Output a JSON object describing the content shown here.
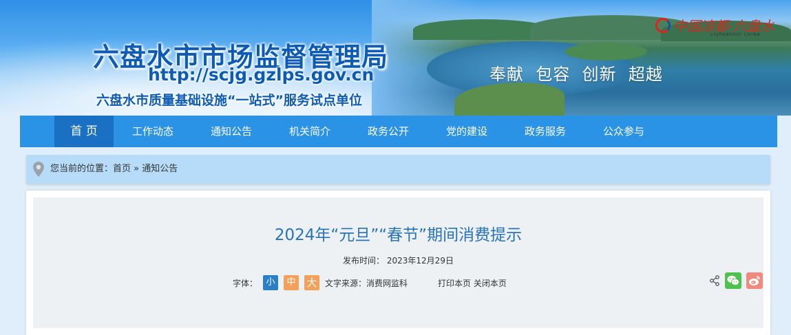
{
  "header": {
    "site_title": "六盘水市市场监督管理局",
    "site_url": "http://scjg.gzlps.gov.cn",
    "subtitle": "六盘水市质量基础设施“一站式”服务试点单位",
    "slogan": "奉献  包容  创新  超越",
    "city_logo_text": "中国凉都·六盘水",
    "city_logo_small": "LIUPANSHUI CHINA"
  },
  "nav": {
    "items": [
      {
        "label": "首 页",
        "active": true
      },
      {
        "label": "工作动态"
      },
      {
        "label": "通知公告"
      },
      {
        "label": "机关简介"
      },
      {
        "label": "政务公开"
      },
      {
        "label": "党的建设"
      },
      {
        "label": "政务服务"
      },
      {
        "label": "公众参与"
      }
    ]
  },
  "breadcrumb": {
    "prefix": "您当前的位置：",
    "home": "首页",
    "sep": "»",
    "current": "通知公告"
  },
  "article": {
    "title": "2024年“元旦”“春节”期间消费提示",
    "date_label": "发布时间：",
    "date": "2023年12月29日",
    "font_label": "字体：",
    "font_small": "小",
    "font_mid": "中",
    "font_large": "大",
    "source_label": "文字来源：",
    "source": "消费网监科",
    "print": "打印本页",
    "close": "关闭本页"
  },
  "colors": {
    "nav_bg": "#2b93e5",
    "nav_active": "#1a71c4",
    "title_blue": "#2773bb",
    "breadcrumb_bg": "#b7dcf9"
  },
  "icons": {
    "breadcrumb": "location-pin-icon",
    "share": "share-icon",
    "wechat": "wechat-icon",
    "weibo": "weibo-icon"
  }
}
